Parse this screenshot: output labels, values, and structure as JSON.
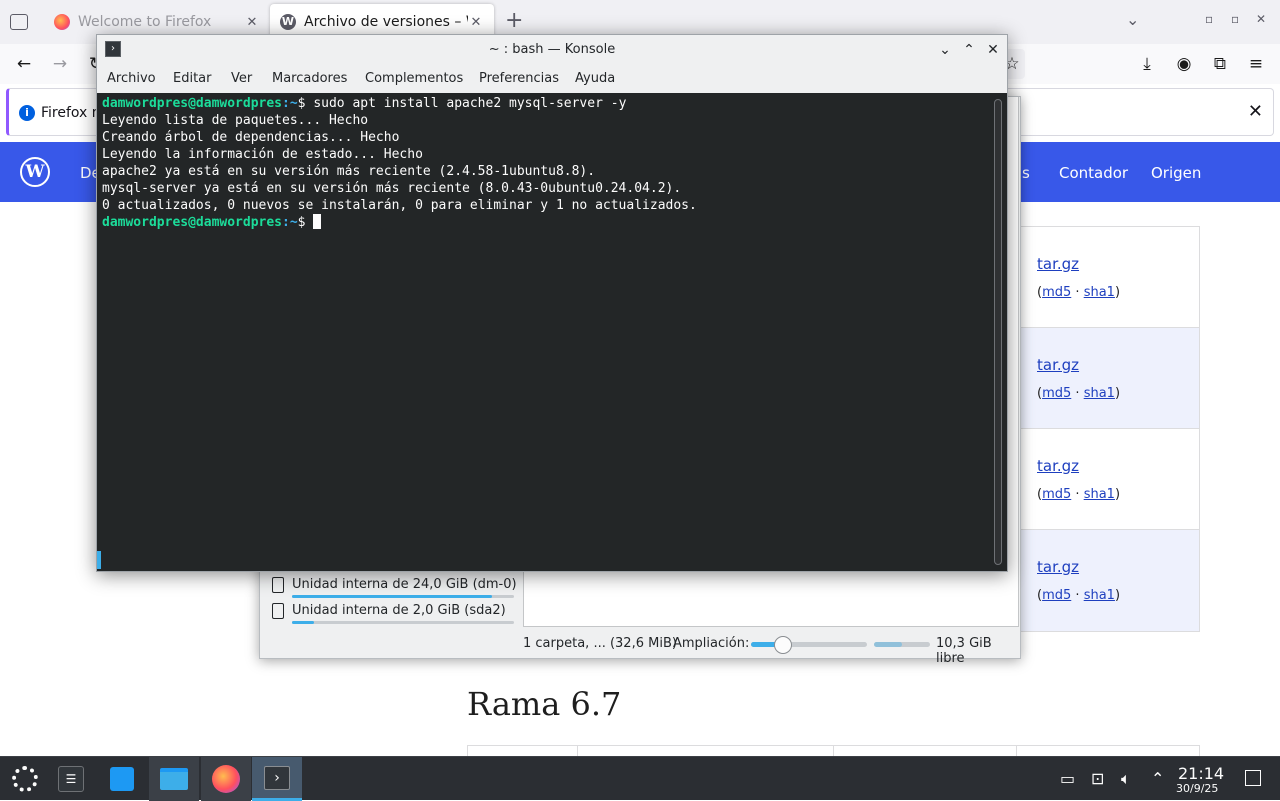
{
  "firefox": {
    "tabs": [
      {
        "title": "Welcome to Firefox",
        "active": false
      },
      {
        "title": "Archivo de versiones – WordPress",
        "active": true
      }
    ],
    "new_tab": "+",
    "notice_text": "Firefox m"
  },
  "wordpress": {
    "nav_partial_left": "De",
    "nav_partial_right": "s",
    "nav_items": [
      "Contador",
      "Origen"
    ],
    "rows": [
      {
        "link": "tar.gz",
        "md5": "md5",
        "sha1": "sha1"
      },
      {
        "link": "tar.gz",
        "md5": "md5",
        "sha1": "sha1"
      },
      {
        "link": "tar.gz",
        "md5": "md5",
        "sha1": "sha1"
      },
      {
        "link": "tar.gz",
        "md5": "md5",
        "sha1": "sha1"
      }
    ],
    "open_paren": "(",
    "separator": "·",
    "close_paren": ")",
    "branch_heading": "Rama 6.7"
  },
  "dolphin": {
    "drives": [
      {
        "label": "Unidad interna de 24,0 GiB (dm-0)",
        "used_fraction": 0.9
      },
      {
        "label": "Unidad interna de 2,0 GiB (sda2)",
        "used_fraction": 0.1
      }
    ],
    "status_summary": "1 carpeta, ... (32,6 MiB)",
    "zoom_label": "Ampliación:",
    "zoom_fraction": 0.28,
    "free_fraction": 0.5,
    "free_space": "10,3 GiB libre"
  },
  "konsole": {
    "title": "~ : bash — Konsole",
    "menu": [
      "Archivo",
      "Editar",
      "Ver",
      "Marcadores",
      "Complementos",
      "Preferencias",
      "Ayuda"
    ],
    "prompt_user": "damwordpres@damwordpres",
    "prompt_path": ":~",
    "prompt_symbol": "$",
    "command": " sudo apt install apache2 mysql-server -y",
    "output": [
      "Leyendo lista de paquetes... Hecho",
      "Creando árbol de dependencias... Hecho",
      "Leyendo la información de estado... Hecho",
      "apache2 ya está en su versión más reciente (2.4.58-1ubuntu8.8).",
      "mysql-server ya está en su versión más reciente (8.0.43-0ubuntu0.24.04.2).",
      "0 actualizados, 0 nuevos se instalarán, 0 para eliminar y 1 no actualizados."
    ]
  },
  "taskbar": {
    "time": "21:14",
    "date": "30/9/25"
  },
  "colors": {
    "wp_blue": "#3858e9",
    "konsole_bg": "#232627",
    "prompt_green": "#1cdc9a",
    "accent": "#3daee9"
  }
}
